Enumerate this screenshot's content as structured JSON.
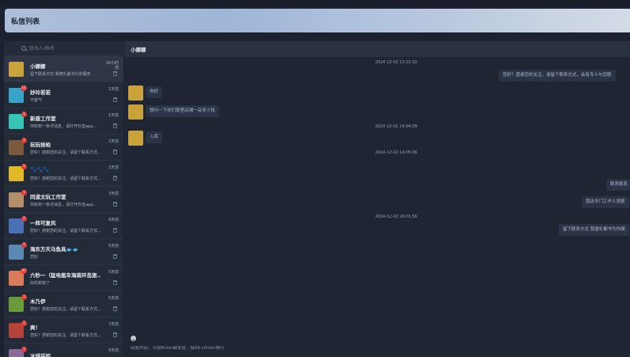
{
  "header": {
    "title": "私信列表"
  },
  "search": {
    "placeholder": "联系人/群名"
  },
  "conversations": [
    {
      "name": "小娜娜",
      "preview": "留下联系方式 我德礼都书为你服务",
      "time": "18小时前",
      "badge": "",
      "avatar_color": "#c9a33a",
      "active": true
    },
    {
      "name": "妙玲若若",
      "preview": "不客气",
      "time": "1天前",
      "badge": "11",
      "avatar_color": "#3aa3c9"
    },
    {
      "name": "新盾工作室",
      "preview": "你收到一条评消息，请打开抖音app...",
      "time": "1天前",
      "badge": "1",
      "avatar_color": "#36c4b4"
    },
    {
      "name": "玩玩拾柏",
      "preview": "您好！感谢您的关注，请留个联系方式...",
      "time": "2天前",
      "badge": "1",
      "avatar_color": "#7a5a3a"
    },
    {
      "name": "🐾🐾🐾",
      "preview": "您好！感谢您的关注，请留个联系方式...",
      "time": "2天前",
      "badge": "1",
      "avatar_color": "#e2b826"
    },
    {
      "name": "同道文玩工作室",
      "preview": "你收到一条评消息，请打开抖音app...",
      "time": "3天前",
      "badge": "1",
      "avatar_color": "#b48f6a"
    },
    {
      "name": "一阵可复风",
      "preview": "您好！感谢您的关注，请留个联系方式...",
      "time": "4天前",
      "badge": "1",
      "avatar_color": "#4a6fb4"
    },
    {
      "name": "海东方天马鱼具🐟🐟",
      "preview": "您好",
      "time": "5天前",
      "badge": "1",
      "avatar_color": "#5a8ab4"
    },
    {
      "name": "六秒一（猛电瓶车海南环岛旅...",
      "preview": "好的谢谢了",
      "time": "5天前",
      "badge": "47",
      "avatar_color": "#d97a5a"
    },
    {
      "name": "木乃伊",
      "preview": "您好！感谢您的关注，请留个联系方式...",
      "time": "5天前",
      "badge": "1",
      "avatar_color": "#6a9a3a"
    },
    {
      "name": "爽！",
      "preview": "您好！感谢您的关注，请留个联系方式...",
      "time": "7天前",
      "badge": "1",
      "avatar_color": "#b4443a"
    },
    {
      "name": "冰城采知",
      "preview": "",
      "time": "9天前",
      "badge": "1",
      "avatar_color": "#8a6a9a"
    }
  ],
  "chat": {
    "title": "小娜娜",
    "timestamps": [
      "2024-12-02 13:22:10",
      "2024-12-02 14:04:09",
      "2024-12-02 14:05:06",
      "2024-12-02 16:01:56"
    ],
    "messages": [
      {
        "side": "right",
        "text": "您好！感谢您的关注，请留个联系方式，会有专人与您联"
      },
      {
        "side": "left",
        "text": "你好"
      },
      {
        "side": "left",
        "text": "想问一下你们那里店铺一朵多少钱"
      },
      {
        "side": "left",
        "text": "入库"
      },
      {
        "side": "right",
        "text": "联系联系"
      },
      {
        "side": "right",
        "text": "我这专门工作人员联"
      },
      {
        "side": "right",
        "text": "留下联系方式 我德礼都书为你服"
      }
    ],
    "composer_placeholder": "回复内容，可按Enter键发送，按Alt+Enter换行"
  }
}
